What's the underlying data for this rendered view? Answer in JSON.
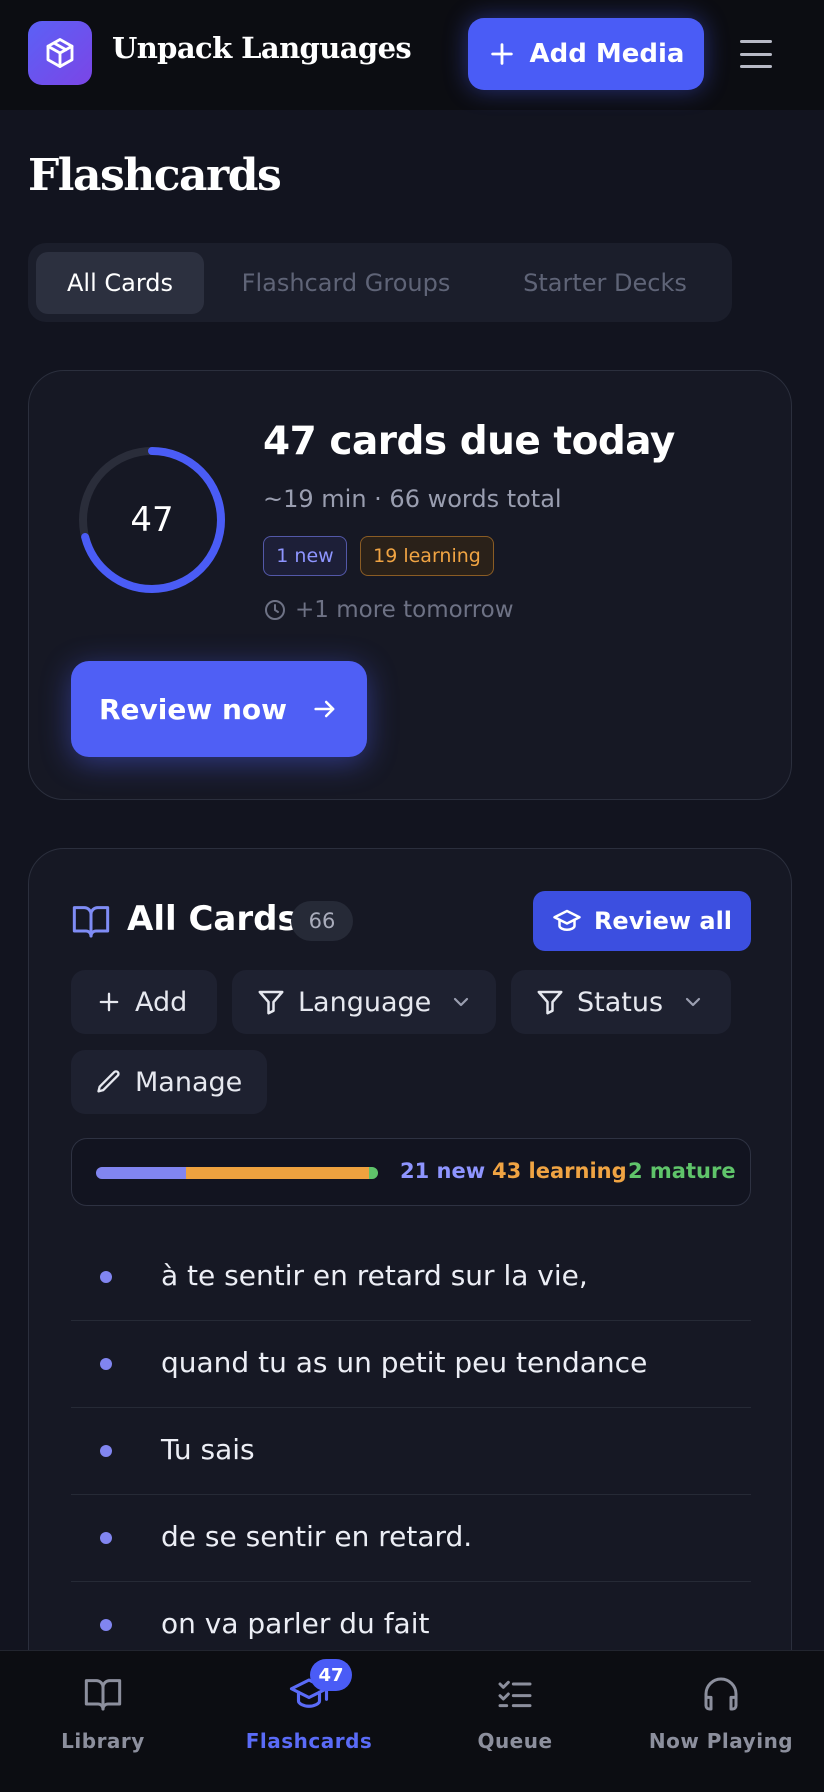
{
  "header": {
    "app_title": "Unpack Languages",
    "add_media_label": "Add Media",
    "logo_icon": "package-icon",
    "menu_icon": "hamburger-icon"
  },
  "page": {
    "title": "Flashcards",
    "tabs": [
      {
        "label": "All Cards",
        "active": true
      },
      {
        "label": "Flashcard Groups",
        "active": false
      },
      {
        "label": "Starter Decks",
        "active": false
      }
    ]
  },
  "due": {
    "count": "47",
    "title": "47 cards due today",
    "subtitle": "~19 min · 66 words total",
    "badge_new": "1 new",
    "badge_learning": "19 learning",
    "tomorrow": "+1 more tomorrow",
    "review_now_label": "Review now",
    "ring_progress": 0.71
  },
  "cards": {
    "title": "All Cards",
    "count": "66",
    "review_all_label": "Review all",
    "add_label": "Add",
    "language_label": "Language",
    "status_label": "Status",
    "manage_label": "Manage",
    "legend_new": "21 new",
    "legend_learning": "43 learning",
    "legend_mature": "2 mature",
    "counts": {
      "new": 21,
      "learning": 43,
      "mature": 2
    },
    "items": [
      "à te sentir en retard sur la vie,",
      "quand tu as un petit peu tendance",
      "Tu sais",
      "de se sentir en retard.",
      "on va parler du fait"
    ]
  },
  "nav": {
    "items": [
      {
        "label": "Library",
        "icon": "book-open-icon",
        "active": false
      },
      {
        "label": "Flashcards",
        "icon": "graduation-cap-icon",
        "active": true,
        "badge": "47"
      },
      {
        "label": "Queue",
        "icon": "list-checks-icon",
        "active": false
      },
      {
        "label": "Now Playing",
        "icon": "headphones-icon",
        "active": false
      }
    ]
  },
  "colors": {
    "accent": "#4a5cf6",
    "new": "#8e95ff",
    "learning": "#f0a443",
    "mature": "#5fc46a",
    "background": "#12141f"
  }
}
